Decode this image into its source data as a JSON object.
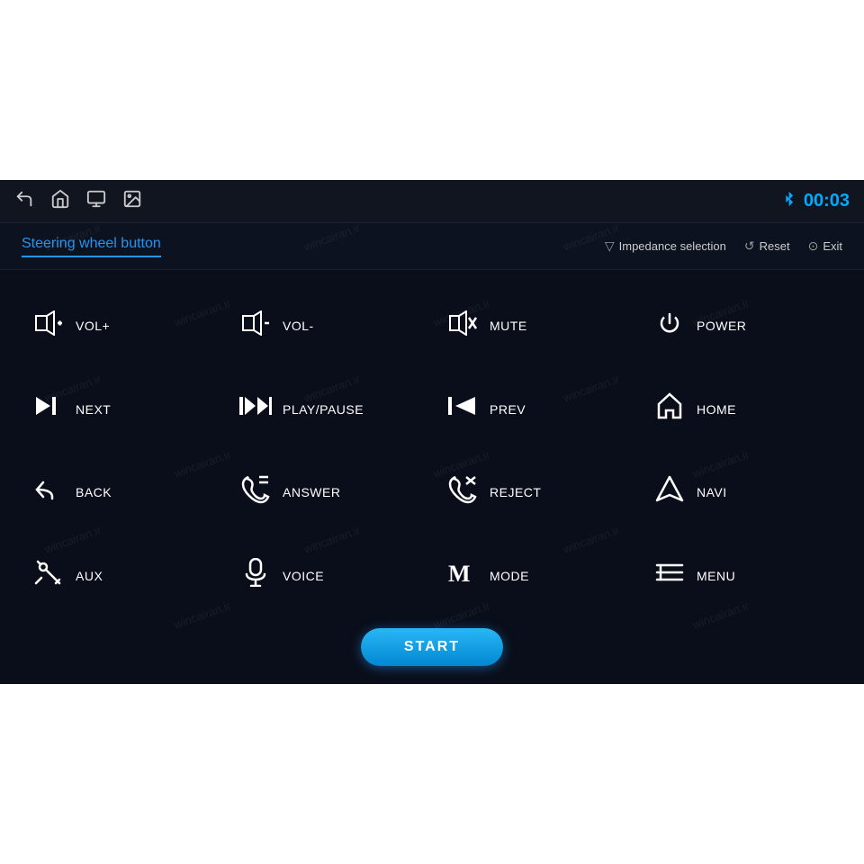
{
  "screen": {
    "background_top": "#ffffff",
    "background_bottom": "#ffffff"
  },
  "top_bar": {
    "clock": "00:03",
    "icons": {
      "back": "↩",
      "home": "⌂",
      "recent": "▣",
      "screenshot": "🖼"
    }
  },
  "sub_header": {
    "title": "Steering wheel button",
    "actions": [
      {
        "id": "impedance",
        "icon": "▽",
        "label": "Impedance selection"
      },
      {
        "id": "reset",
        "icon": "↺",
        "label": "Reset"
      },
      {
        "id": "exit",
        "icon": "⊙",
        "label": "Exit"
      }
    ]
  },
  "buttons": [
    {
      "id": "vol_plus",
      "icon": "vol_plus",
      "label": "VOL+"
    },
    {
      "id": "vol_minus",
      "icon": "vol_minus",
      "label": "VOL-"
    },
    {
      "id": "mute",
      "icon": "mute",
      "label": "MUTE"
    },
    {
      "id": "power",
      "icon": "power",
      "label": "POWER"
    },
    {
      "id": "next",
      "icon": "next",
      "label": "NEXT"
    },
    {
      "id": "play_pause",
      "icon": "play_pause",
      "label": "PLAY/PAUSE"
    },
    {
      "id": "prev",
      "icon": "prev",
      "label": "PREV"
    },
    {
      "id": "home",
      "icon": "home",
      "label": "HOME"
    },
    {
      "id": "back",
      "icon": "back",
      "label": "BACK"
    },
    {
      "id": "answer",
      "icon": "answer",
      "label": "ANSWER"
    },
    {
      "id": "reject",
      "icon": "reject",
      "label": "REJECT"
    },
    {
      "id": "navi",
      "icon": "navi",
      "label": "NAVI"
    },
    {
      "id": "aux",
      "icon": "aux",
      "label": "AUX"
    },
    {
      "id": "voice",
      "icon": "voice",
      "label": "VOICE"
    },
    {
      "id": "mode",
      "icon": "mode",
      "label": "MODE"
    },
    {
      "id": "menu",
      "icon": "menu",
      "label": "MENU"
    }
  ],
  "start_button": {
    "label": "START"
  },
  "watermark_text": "wincairan.ir"
}
